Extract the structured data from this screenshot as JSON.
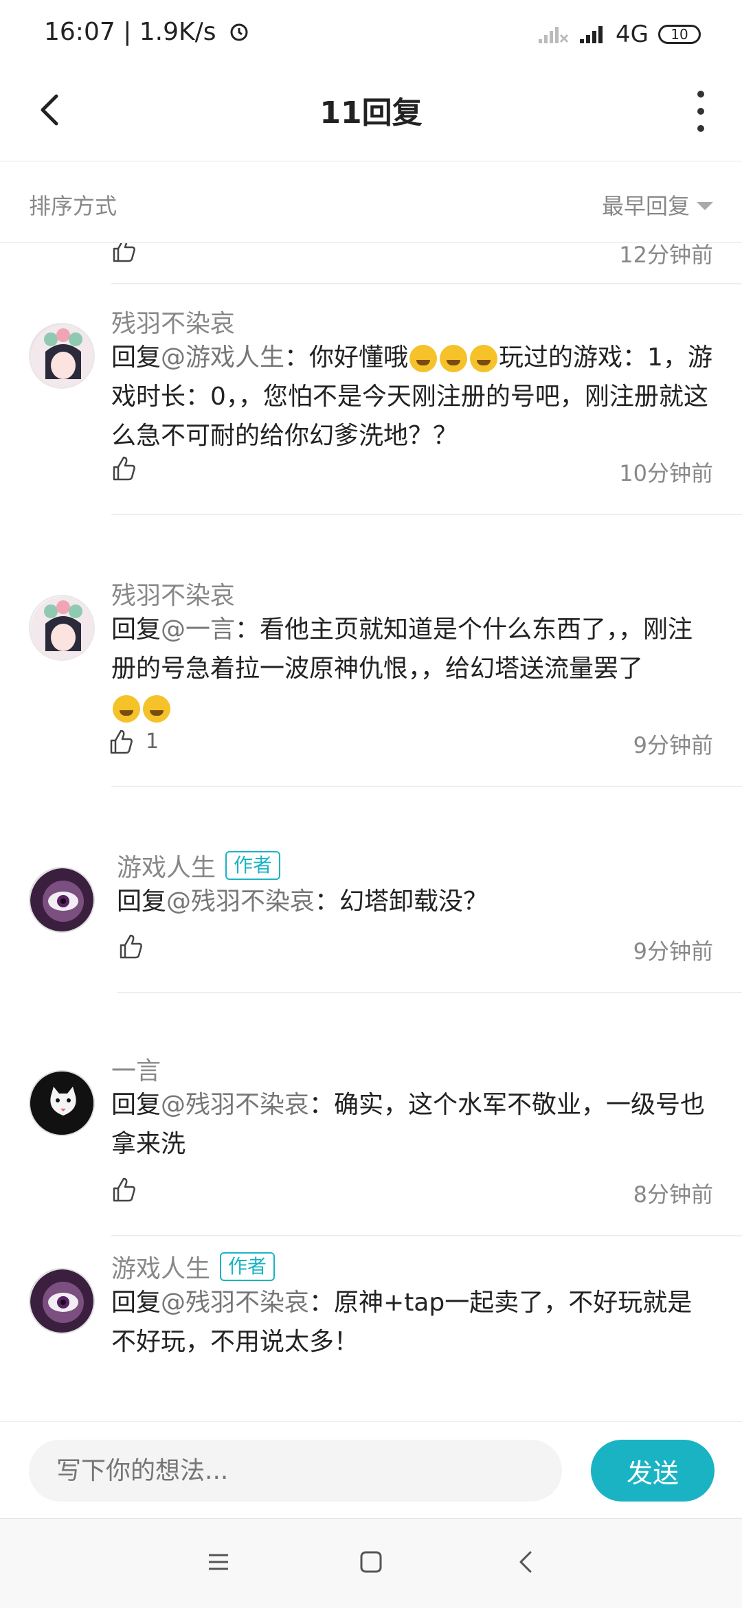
{
  "status_bar": {
    "time": "16:07",
    "speed": "1.9K/s",
    "network": "4G",
    "battery": "10"
  },
  "header": {
    "title": "11回复"
  },
  "sort": {
    "label": "排序方式",
    "value": "最早回复"
  },
  "first_partial": {
    "time": "12分钟前"
  },
  "comments": [
    {
      "user": "残羽不染哀",
      "reply_prefix": "回复",
      "mention": "@游戏人生",
      "body_pre": "：你好懂哦",
      "body_post": "玩过的游戏：1，游戏时长：0，，您怕不是今天刚注册的号吧，刚注册就这么急不可耐的给你幻爹洗地？？",
      "time": "10分钟前"
    },
    {
      "user": "残羽不染哀",
      "reply_prefix": "回复",
      "mention": "@一言",
      "body": "：看他主页就知道是个什么东西了，，刚注册的号急着拉一波原神仇恨，，给幻塔送流量罢了",
      "likes": "1",
      "time": "9分钟前"
    },
    {
      "user": "游戏人生",
      "badge": "作者",
      "reply_prefix": "回复",
      "mention": "@残羽不染哀",
      "body": "：幻塔卸载没？",
      "time": "9分钟前"
    },
    {
      "user": "一言",
      "reply_prefix": "回复",
      "mention": "@残羽不染哀",
      "body": "：确实，这个水军不敬业，一级号也拿来洗",
      "time": "8分钟前"
    },
    {
      "user": "游戏人生",
      "badge": "作者",
      "reply_prefix": "回复",
      "mention": "@残羽不染哀",
      "body": "：原神+tap一起卖了，不好玩就是不好玩，不用说太多！"
    }
  ],
  "input": {
    "placeholder": "写下你的想法..."
  },
  "send_label": "发送",
  "colors": {
    "accent": "#1ab3c4",
    "mention": "#777777"
  }
}
